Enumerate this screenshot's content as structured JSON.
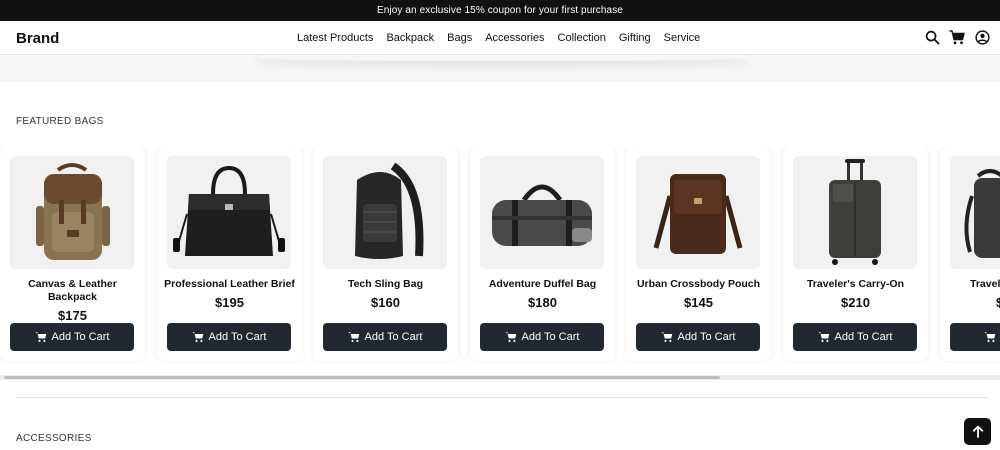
{
  "promo": {
    "text": "Enjoy an exclusive 15% coupon for your first purchase"
  },
  "header": {
    "brand": "Brand",
    "nav": [
      "Latest Products",
      "Backpack",
      "Bags",
      "Accessories",
      "Collection",
      "Gifting",
      "Service"
    ],
    "icons": [
      "search-icon",
      "cart-icon",
      "user-icon"
    ]
  },
  "sections": {
    "featured_title": "FEATURED BAGS",
    "accessories_title": "ACCESSORIES"
  },
  "products": [
    {
      "name": "Canvas & Leather Backpack",
      "price": "$175",
      "button": "Add To Cart",
      "image": "backpack-image"
    },
    {
      "name": "Professional Leather Brief",
      "price": "$195",
      "button": "Add To Cart",
      "image": "briefcase-image"
    },
    {
      "name": "Tech Sling Bag",
      "price": "$160",
      "button": "Add To Cart",
      "image": "sling-bag-image"
    },
    {
      "name": "Adventure Duffel Bag",
      "price": "$180",
      "button": "Add To Cart",
      "image": "duffel-bag-image"
    },
    {
      "name": "Urban Crossbody Pouch",
      "price": "$145",
      "button": "Add To Cart",
      "image": "crossbody-pouch-image"
    },
    {
      "name": "Traveler's Carry-On",
      "price": "$210",
      "button": "Add To Cart",
      "image": "suitcase-image"
    },
    {
      "name": "Travel",
      "price": "$",
      "button": "A",
      "image": "travel-backpack-image"
    }
  ],
  "colors": {
    "button_bg": "#222831",
    "promo_bg": "#111111",
    "card_image_bg": "#f1f1f1"
  }
}
